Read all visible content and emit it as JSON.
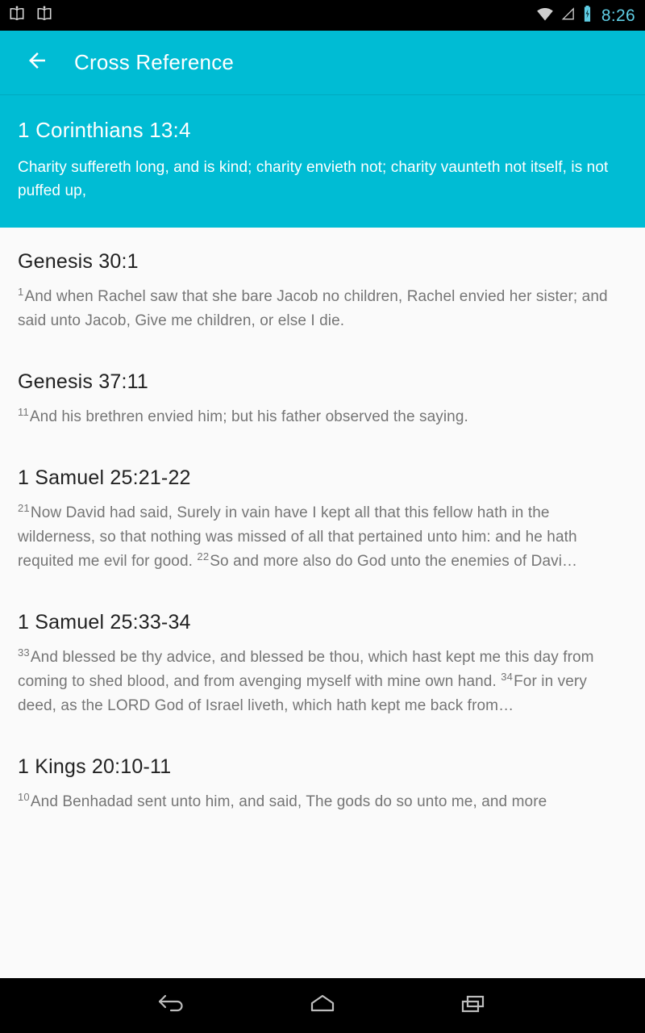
{
  "statusbar": {
    "notification_icons": [
      "book-icon",
      "book-icon"
    ],
    "wifi_icon": "wifi-icon",
    "signal_icon": "signal-icon",
    "battery_icon": "battery-charging-icon",
    "time": "8:26",
    "time_color": "#5fcde4"
  },
  "appbar": {
    "back_icon": "arrow-back-icon",
    "title": "Cross Reference",
    "background": "#00bcd4",
    "text_color": "#ffffff"
  },
  "source_verse": {
    "reference": "1 Corinthians 13:4",
    "text": "Charity suffereth long, and is kind; charity envieth not; charity vaunteth not itself, is not puffed up,",
    "background": "#00bcd4"
  },
  "cross_references": [
    {
      "reference": "Genesis 30:1",
      "segments": [
        {
          "verse_number": "1",
          "text": "And when Rachel saw that she bare Jacob no children, Rachel envied her sister; and said unto Jacob, Give me children, or else I die."
        }
      ]
    },
    {
      "reference": "Genesis 37:11",
      "segments": [
        {
          "verse_number": "11",
          "text": "And his brethren envied him; but his father observed the saying."
        }
      ]
    },
    {
      "reference": "1 Samuel 25:21-22",
      "segments": [
        {
          "verse_number": "21",
          "text": "Now David had said, Surely in vain have I kept all that this fellow hath in the wilderness, so that nothing was missed of all that pertained unto him: and he hath requited me evil for good. "
        },
        {
          "verse_number": "22",
          "text": "So and more also do God unto the enemies of Davi…"
        }
      ]
    },
    {
      "reference": "1 Samuel 25:33-34",
      "segments": [
        {
          "verse_number": "33",
          "text": "And blessed be thy advice, and blessed be thou, which hast kept me this day from coming to shed blood, and from avenging myself with mine own hand. "
        },
        {
          "verse_number": "34",
          "text": "For in very deed, as the LORD God of Israel liveth, which hath kept me back from…"
        }
      ]
    },
    {
      "reference": "1 Kings 20:10-11",
      "segments": [
        {
          "verse_number": "10",
          "text": "And Benhadad sent unto him, and said, The gods do so unto me, and more"
        }
      ]
    }
  ],
  "navbar": {
    "back_icon": "nav-back-icon",
    "home_icon": "nav-home-icon",
    "recents_icon": "nav-recents-icon"
  },
  "colors": {
    "accent": "#00bcd4",
    "page_background": "#fafafa",
    "heading_text": "#212121",
    "body_text": "#757575"
  }
}
